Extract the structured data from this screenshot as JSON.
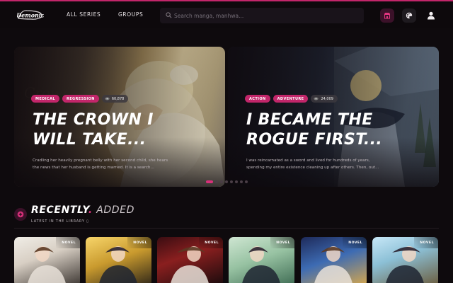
{
  "header": {
    "logo_text": "Demonic",
    "nav": [
      {
        "label": "ALL SERIES"
      },
      {
        "label": "GROUPS"
      }
    ],
    "search": {
      "placeholder": "Search manga, manhwa..."
    },
    "icons": [
      "store-icon",
      "palette-icon",
      "user-icon"
    ],
    "accent_color": "#c2266a"
  },
  "carousel": {
    "slides": [
      {
        "tags": [
          "MEDICAL",
          "REGRESSION"
        ],
        "views": "60,878",
        "title": "THE CROWN I WILL TAKE...",
        "description": "Cradling her heavily pregnant belly with her second child, she hears the news that her husband is getting married. It is a search..."
      },
      {
        "tags": [
          "ACTION",
          "ADVENTURE"
        ],
        "views": "24,009",
        "title": "I BECAME THE ROGUE FIRST...",
        "description": "I was reincarnated as a sword and lived for hundreds of years, spending my entire existence cleaning up after others. Then, out..."
      }
    ],
    "dot_count": 8,
    "active_dot": 0
  },
  "recent": {
    "title_main": "RECENTLY",
    "title_dot": ".",
    "title_rest": "ADDED",
    "subtitle": "LATEST IN THE LIBRARY ▯",
    "cards": [
      {
        "badge": "NOVEL"
      },
      {
        "badge": "NOVEL"
      },
      {
        "badge": "NOVEL"
      },
      {
        "badge": "NOVEL"
      },
      {
        "badge": "NOVEL"
      },
      {
        "badge": "NOVEL"
      }
    ]
  }
}
